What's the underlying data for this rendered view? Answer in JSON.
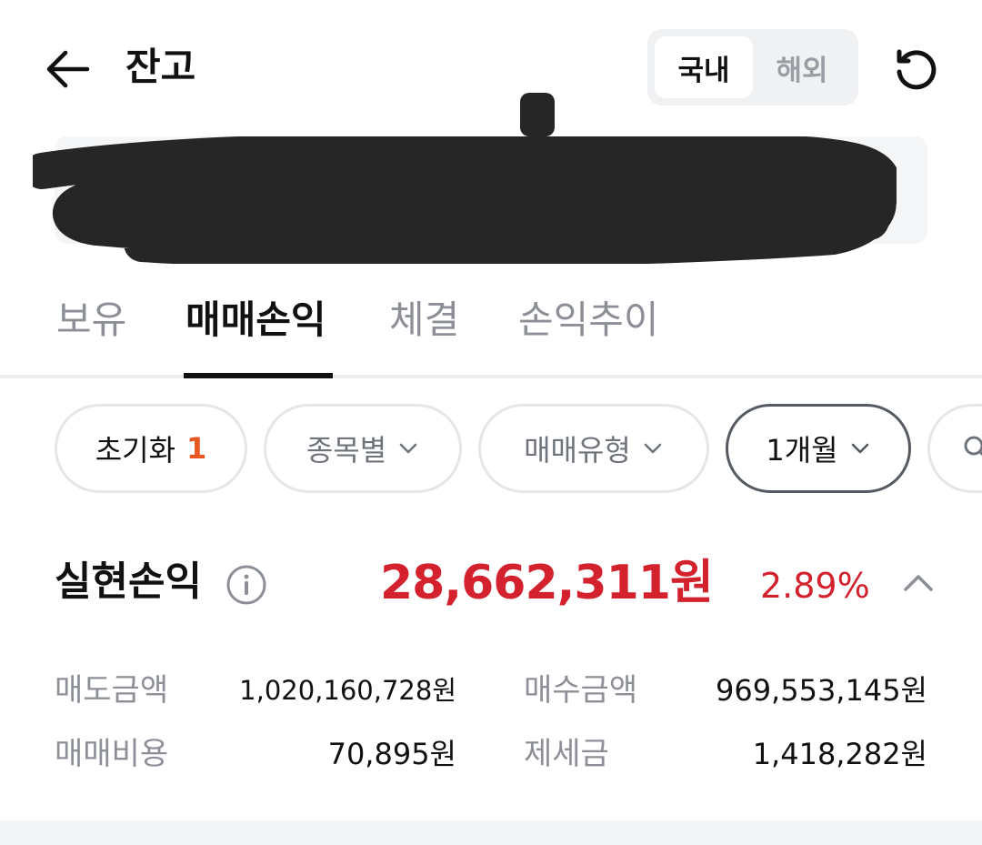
{
  "header": {
    "title": "잔고",
    "segments": [
      {
        "label": "국내",
        "active": true
      },
      {
        "label": "해외",
        "active": false
      }
    ],
    "icons": {
      "back": "arrow-left-icon",
      "refresh": "refresh-icon"
    }
  },
  "tabs": [
    {
      "label": "보유",
      "active": false
    },
    {
      "label": "매매손익",
      "active": true
    },
    {
      "label": "체결",
      "active": false
    },
    {
      "label": "손익추이",
      "active": false
    }
  ],
  "filters": {
    "reset_label": "초기화",
    "reset_count": "1",
    "stock_label": "종목별",
    "trade_type_label": "매매유형",
    "period_label": "1개월"
  },
  "realized": {
    "label": "실현손익",
    "amount": "28,662,311원",
    "rate": "2.89%"
  },
  "details": {
    "sell_amount_label": "매도금액",
    "sell_amount_value": "1,020,160,728원",
    "buy_amount_label": "매수금액",
    "buy_amount_value": "969,553,145원",
    "trade_cost_label": "매매비용",
    "trade_cost_value": "70,895원",
    "tax_label": "제세금",
    "tax_value": "1,418,282원"
  },
  "colors": {
    "accent_red": "#d3222e",
    "reset_count_orange": "#e8571f",
    "muted_text": "#8c9096"
  }
}
